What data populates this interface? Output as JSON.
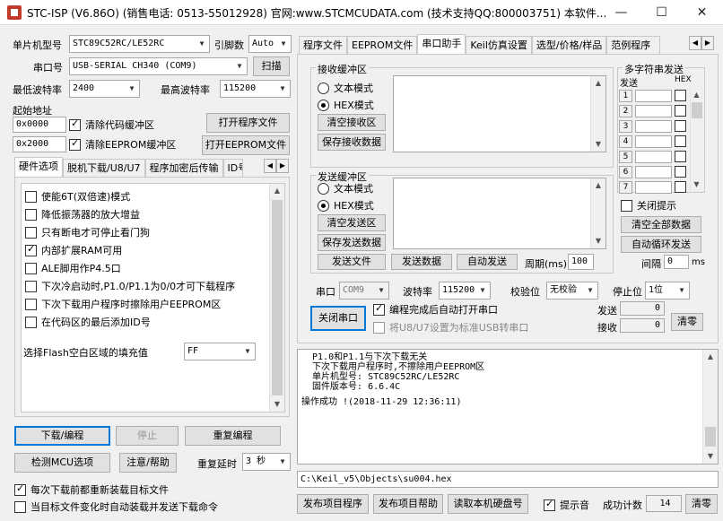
{
  "window": {
    "title": "STC-ISP (V6.86O) (销售电话: 0513-55012928) 官网:www.STCMCUDATA.com  (技术支持QQ:800003751) 本软件...",
    "minimize": "—",
    "maximize": "☐",
    "close": "✕"
  },
  "left": {
    "mcu_label": "单片机型号",
    "mcu_value": "STC89C52RC/LE52RC",
    "pin_label": "引脚数",
    "pin_value": "Auto",
    "port_label": "串口号",
    "port_value": "USB-SERIAL CH340 (COM9)",
    "scan_button": "扫描",
    "min_baud_label": "最低波特率",
    "min_baud_value": "2400",
    "max_baud_label": "最高波特率",
    "max_baud_value": "115200",
    "start_addr_label": "起始地址",
    "addr1": "0x0000",
    "clear_code_label": "清除代码缓冲区",
    "open_program_button": "打开程序文件",
    "addr2": "0x2000",
    "clear_eeprom_label": "清除EEPROM缓冲区",
    "open_eeprom_button": "打开EEPROM文件",
    "tabs": [
      "硬件选项",
      "脱机下载/U8/U7",
      "程序加密后传输",
      "ID号"
    ],
    "options": [
      {
        "label": "使能6T(双倍速)模式",
        "checked": false
      },
      {
        "label": "降低振荡器的放大增益",
        "checked": false
      },
      {
        "label": "只有断电才可停止看门狗",
        "checked": false
      },
      {
        "label": "内部扩展RAM可用",
        "checked": true
      },
      {
        "label": "ALE脚用作P4.5口",
        "checked": false
      },
      {
        "label": "下次冷启动时,P1.0/P1.1为0/0才可下载程序",
        "checked": false
      },
      {
        "label": "下次下载用户程序时擦除用户EEPROM区",
        "checked": false
      },
      {
        "label": "在代码区的最后添加ID号",
        "checked": false
      }
    ],
    "flash_fill_label": "选择Flash空白区域的填充值",
    "flash_fill_value": "FF",
    "download_button": "下载/编程",
    "stop_button": "停止",
    "reprogram_button": "重复编程",
    "check_mcu_button": "检测MCU选项",
    "help_button": "注意/帮助",
    "repeat_delay_label": "重复延时",
    "repeat_delay_value": "3 秒",
    "reload_label": "每次下载前都重新装载目标文件",
    "autoload_label": "当目标文件变化时自动装载并发送下载命令"
  },
  "right": {
    "tabs": [
      "程序文件",
      "EEPROM文件",
      "串口助手",
      "Keil仿真设置",
      "选型/价格/样品",
      "范例程序"
    ],
    "recv_group": "接收缓冲区",
    "text_mode": "文本模式",
    "hex_mode": "HEX模式",
    "clear_recv_button": "清空接收区",
    "save_recv_button": "保存接收数据",
    "send_group": "发送缓冲区",
    "clear_send_button": "清空发送区",
    "save_send_button": "保存发送数据",
    "send_file_button": "发送文件",
    "send_data_button": "发送数据",
    "auto_send_button": "自动发送",
    "period_label": "周期(ms)",
    "period_value": "100",
    "multi_group": "多字符串发送",
    "multi_send_header": "发送",
    "multi_hex_header": "HEX",
    "multi_rows": [
      "1",
      "2",
      "3",
      "4",
      "5",
      "6",
      "7"
    ],
    "close_prompt_label": "关闭提示",
    "clear_all_button": "清空全部数据",
    "auto_loop_button": "自动循环发送",
    "interval_label": "间隔",
    "interval_value": "0",
    "interval_unit": "ms",
    "serial_label": "串口",
    "serial_value": "COM9",
    "baud_label": "波特率",
    "baud_value": "115200",
    "parity_label": "校验位",
    "parity_value": "无校验",
    "stopbit_label": "停止位",
    "stopbit_value": "1位",
    "close_port_button": "关闭串口",
    "auto_open_label": "编程完成后自动打开串口",
    "usb_label": "将U8/U7设置为标准USB转串口",
    "sent_label": "发送",
    "sent_value": "0",
    "recv_label": "接收",
    "recv_value": "0",
    "clear_button": "清零",
    "log_lines": [
      "  P1.0和P1.1与下次下载无关",
      "  下次下载用户程序时,不擦除用户EEPROM区",
      "",
      "  单片机型号: STC89C52RC/LE52RC",
      "  固件版本号: 6.6.4C",
      "",
      "",
      "操作成功 !(2018-11-29 12:36:11)"
    ],
    "path_value": "C:\\Keil_v5\\Objects\\su004.hex",
    "publish_program_button": "发布项目程序",
    "publish_help_button": "发布项目帮助",
    "read_disk_button": "读取本机硬盘号",
    "beep_label": "提示音",
    "success_count_label": "成功计数",
    "success_count_value": "14",
    "clear_count_button": "清零"
  }
}
